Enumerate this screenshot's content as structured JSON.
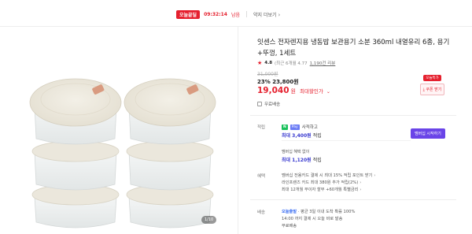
{
  "topbar": {
    "badge": "오늘끝딜",
    "timer": "09:32:14",
    "timer_suffix": "남음",
    "promo_link": "약지 더보기"
  },
  "gallery": {
    "counter": "1/10"
  },
  "product": {
    "title": "잇센스 전자렌지용 냉동밥 보관용기 소분 360ml 내열유리 6종, 용기+뚜껑, 1세트",
    "rating": {
      "score": "4.8",
      "meta": "(최근 6개월 4.77",
      "reviews": "1,190건 리뷰"
    },
    "original_price": "31,000원",
    "discount_rate": "23%",
    "sale_price": "23,800원",
    "final_price": "19,040",
    "final_unit": "원",
    "final_label": "최대할인가",
    "shipping_inline": "무료배송"
  },
  "coupon": {
    "tag": "오늘특가",
    "button": "쿠폰 받기"
  },
  "points": {
    "label": "적립",
    "badge_n": "N",
    "badge_pay": "Pay",
    "head_text": "사적하고",
    "amount_prefix": "최대",
    "amount": "3,400원",
    "amount_suffix": "적립",
    "button": "멤버십 시작하기",
    "sub": "멤버십 혜택 없이",
    "amount2_prefix": "최대",
    "amount2": "1,120원",
    "amount2_suffix": "적립"
  },
  "benefits": {
    "label": "혜택",
    "lines": [
      "멤버십 전용카드 결제 시 최대 15% 적립 포인트 받기",
      "라인프렌즈 카드 최대 380원 추가 적립(2%)",
      "최대 12개월 무이자 할부 +60개월 특별금리"
    ]
  },
  "delivery": {
    "label": "배송",
    "badge": "오늘출발",
    "line1": "· 평균 3일 이내 도착 확률 100%",
    "line2": "14:00 까지 결제 시 오늘 바로 발송",
    "line3": "무료배송"
  },
  "colors": {
    "accent": "#e5202e",
    "points_purple": "#6a44e8",
    "naver_green": "#19c15a"
  }
}
